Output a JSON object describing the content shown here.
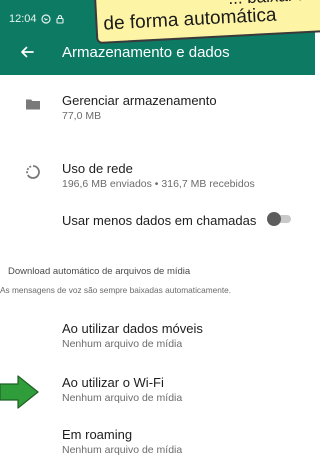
{
  "status_bar": {
    "time": "12:04"
  },
  "overlay": {
    "line1": "... baixar m",
    "line2": "de forma automática"
  },
  "header": {
    "title": "Armazenamento e dados"
  },
  "storage": {
    "title": "Gerenciar armazenamento",
    "subtitle": "77,0 MB"
  },
  "network": {
    "title": "Uso de rede",
    "subtitle": "196,6 MB enviados • 316,7 MB recebidos"
  },
  "calls": {
    "title": "Usar menos dados em chamadas",
    "enabled": false
  },
  "auto_download": {
    "section_title": "Download automático de arquivos de mídia",
    "section_note": "As mensagens de voz são sempre baixadas automaticamente.",
    "items": [
      {
        "title": "Ao utilizar dados móveis",
        "subtitle": "Nenhum arquivo de mídia"
      },
      {
        "title": "Ao utilizar o Wi-Fi",
        "subtitle": "Nenhum arquivo de mídia"
      },
      {
        "title": "Em roaming",
        "subtitle": "Nenhum arquivo de mídia"
      }
    ]
  },
  "colors": {
    "header": "#0d7a64",
    "banner": "#fdf4a5",
    "arrow": "#2f9e3a"
  },
  "icons": [
    "whatsapp-status-icon",
    "lock-icon",
    "back-arrow-icon",
    "folder-icon",
    "data-usage-icon",
    "toggle-switch",
    "green-pointer-arrow-icon"
  ]
}
